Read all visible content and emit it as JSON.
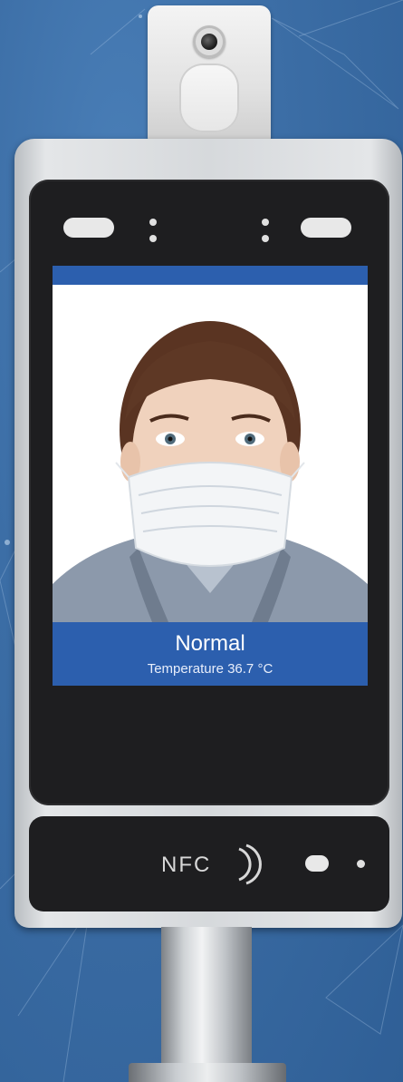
{
  "screen": {
    "status": "Normal",
    "temperature_text": "Temperature 36.7 °C"
  },
  "lower_panel": {
    "nfc_label": "NFC"
  },
  "colors": {
    "background": "#3c6ea6",
    "display_accent": "#2c5fae",
    "panel": "#1e1e20"
  },
  "icons": [
    "camera-lens-icon",
    "nfc-icon"
  ]
}
